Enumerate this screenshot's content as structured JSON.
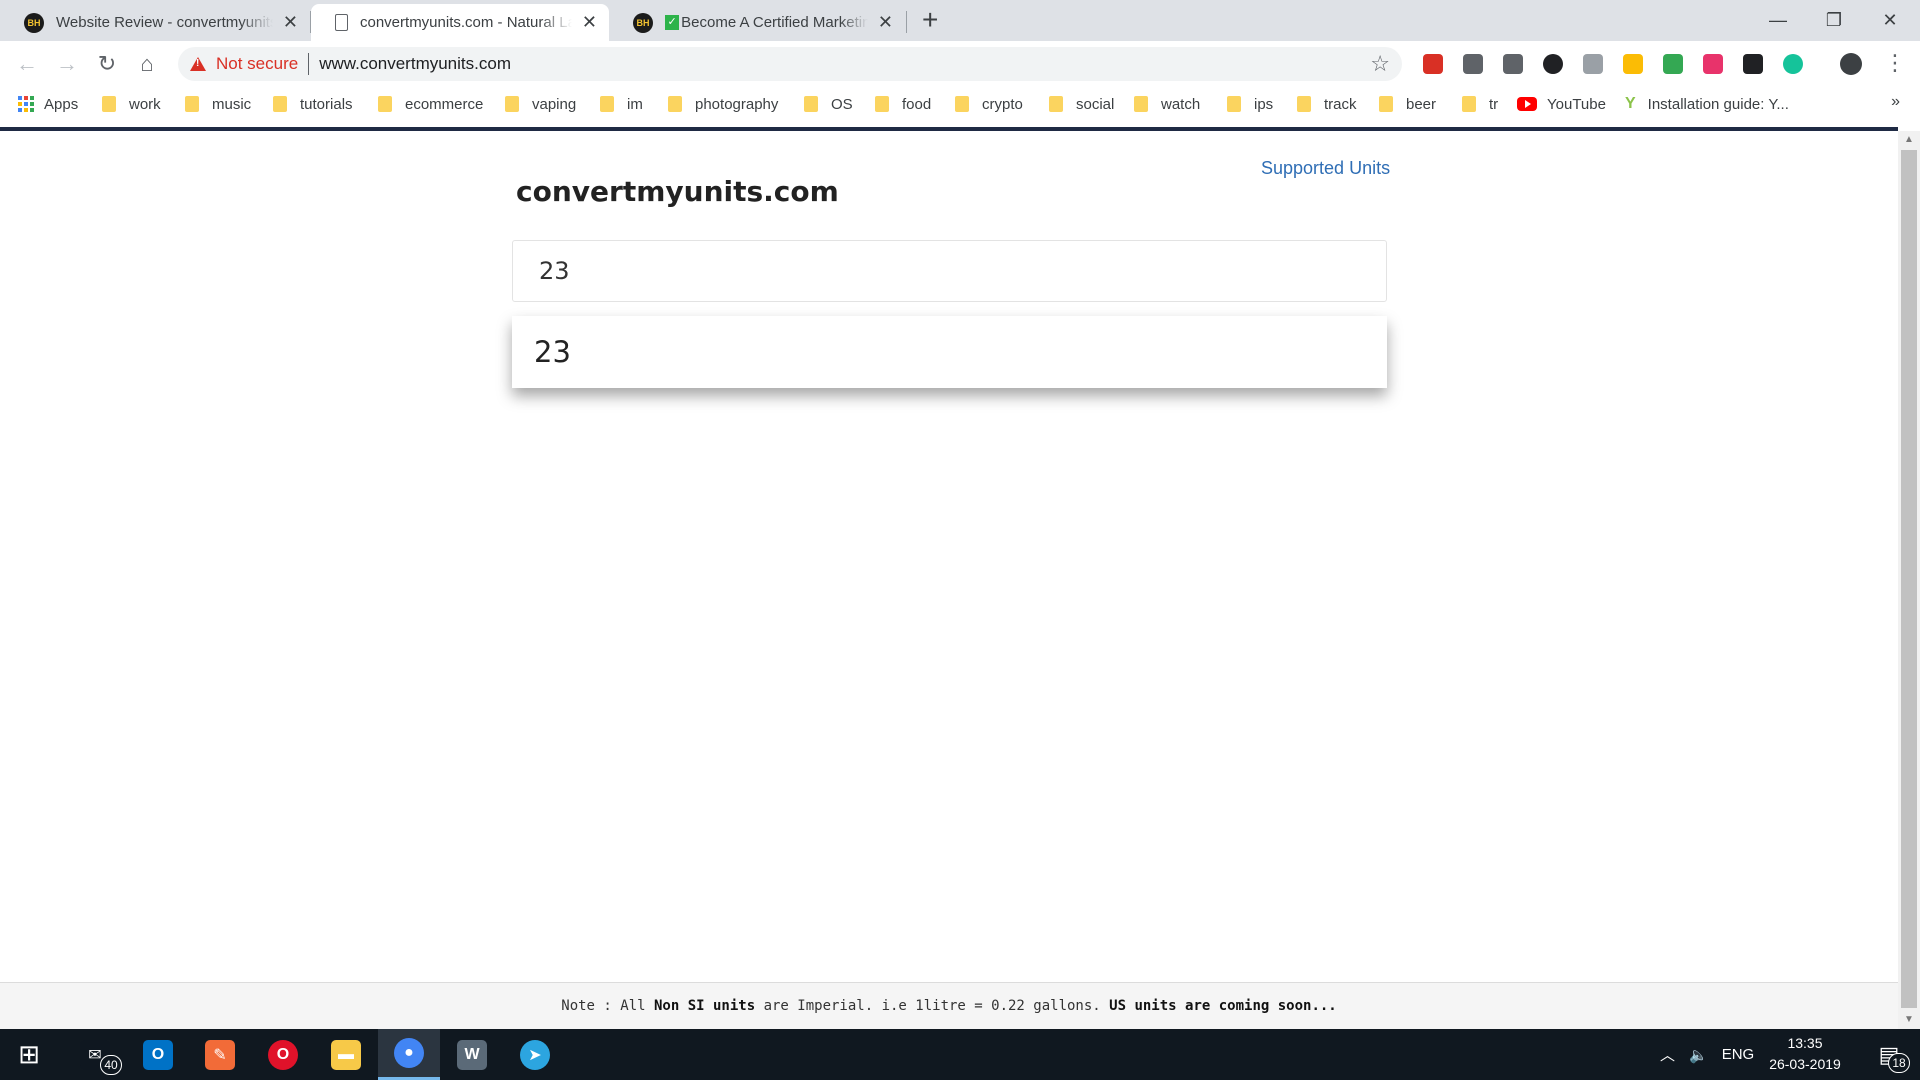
{
  "browser": {
    "tabs": [
      {
        "title": "Website Review - convertmyunits",
        "favicon": "bh-logo-icon"
      },
      {
        "title": "convertmyunits.com - Natural La",
        "favicon": "document-icon"
      },
      {
        "title": "Become A Certified Marketing",
        "favicon": "bh-logo-icon"
      }
    ],
    "tab_favicon_text": "BH",
    "tab_check_mark": "✓",
    "close_glyph": "✕",
    "new_tab_glyph": "+",
    "window_controls": {
      "minimize": "—",
      "maximize": "❐",
      "close": "✕"
    },
    "nav": {
      "back": "←",
      "forward": "→",
      "reload": "↻",
      "home": "⌂"
    },
    "security_label": "Not secure",
    "url": "www.convertmyunits.com",
    "star_glyph": "☆",
    "menu_glyph": "⋮",
    "bookmarks_more": "»",
    "bookmarks": [
      {
        "label": "Apps",
        "icon": "apps-grid-icon"
      },
      {
        "label": "work",
        "icon": "folder-icon"
      },
      {
        "label": "music",
        "icon": "folder-icon"
      },
      {
        "label": "tutorials",
        "icon": "folder-icon"
      },
      {
        "label": "ecommerce",
        "icon": "folder-icon"
      },
      {
        "label": "vaping",
        "icon": "folder-icon"
      },
      {
        "label": "im",
        "icon": "folder-icon"
      },
      {
        "label": "photography",
        "icon": "folder-icon"
      },
      {
        "label": "OS",
        "icon": "folder-icon"
      },
      {
        "label": "food",
        "icon": "folder-icon"
      },
      {
        "label": "crypto",
        "icon": "folder-icon"
      },
      {
        "label": "social",
        "icon": "folder-icon"
      },
      {
        "label": "watch",
        "icon": "folder-icon"
      },
      {
        "label": "ips",
        "icon": "folder-icon"
      },
      {
        "label": "track",
        "icon": "folder-icon"
      },
      {
        "label": "beer",
        "icon": "folder-icon"
      },
      {
        "label": "tr",
        "icon": "folder-icon"
      },
      {
        "label": "YouTube",
        "icon": "youtube-icon"
      },
      {
        "label": "Installation guide: Y...",
        "icon": "y-logo-icon"
      }
    ],
    "extension_colors": [
      "#d93025",
      "#5f6368",
      "#5f6368",
      "#202124",
      "#9aa0a6",
      "#fbbc05",
      "#34a853",
      "#e8336b",
      "#202124",
      "#15c39a",
      "#3c4043"
    ]
  },
  "site": {
    "title": "convertmyunits.com",
    "supported_units_link": "Supported Units",
    "query_value": "23",
    "result_value": "23",
    "footer": {
      "prefix": "Note : All ",
      "bold1": "Non SI units",
      "middle": " are Imperial. i.e 1litre = 0.22 gallons. ",
      "bold2": "US units are coming soon..."
    }
  },
  "scrollbar": {
    "up": "▲",
    "down": "▼"
  },
  "taskbar": {
    "start_glyph": "⊞",
    "mail_badge": "40",
    "apps": [
      {
        "name": "mail-app",
        "label": "✉",
        "color": "#0f1720"
      },
      {
        "name": "outlook-app",
        "label": "O",
        "color": "#0072c6"
      },
      {
        "name": "feather-app",
        "label": "✎",
        "color": "#f26b38"
      },
      {
        "name": "opera-app",
        "label": "O",
        "color": "#e0122a"
      },
      {
        "name": "file-explorer-app",
        "label": "▬",
        "color": "#f7c948"
      },
      {
        "name": "chrome-app",
        "label": "●",
        "color": "#4285f4"
      },
      {
        "name": "wordpress-app",
        "label": "W",
        "color": "#5b6a78"
      },
      {
        "name": "telegram-app",
        "label": "➤",
        "color": "#2ca5e0"
      }
    ],
    "tray": {
      "chevron": "︿",
      "volume": "🔈",
      "language": "ENG"
    },
    "clock": {
      "time": "13:35",
      "date": "26-03-2019"
    },
    "notification_badge": "18",
    "notification_glyph": "▤"
  }
}
